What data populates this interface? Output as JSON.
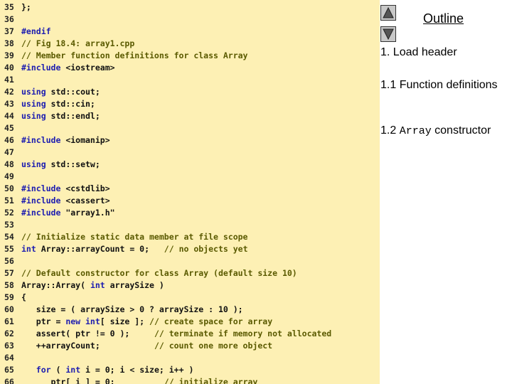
{
  "code": [
    {
      "n": "35",
      "parts": [
        {
          "t": "plain",
          "s": "};"
        }
      ]
    },
    {
      "n": "36",
      "parts": []
    },
    {
      "n": "37",
      "parts": [
        {
          "t": "pre",
          "s": "#endif"
        }
      ]
    },
    {
      "n": "38",
      "parts": [
        {
          "t": "comment",
          "s": "// Fig 18.4: array1.cpp"
        }
      ]
    },
    {
      "n": "39",
      "parts": [
        {
          "t": "comment",
          "s": "// Member function definitions for class Array"
        }
      ]
    },
    {
      "n": "40",
      "parts": [
        {
          "t": "pre",
          "s": "#include "
        },
        {
          "t": "plain",
          "s": "<iostream>"
        }
      ]
    },
    {
      "n": "41",
      "parts": []
    },
    {
      "n": "42",
      "parts": [
        {
          "t": "kw",
          "s": "using "
        },
        {
          "t": "plain",
          "s": "std::cout;"
        }
      ]
    },
    {
      "n": "43",
      "parts": [
        {
          "t": "kw",
          "s": "using "
        },
        {
          "t": "plain",
          "s": "std::cin;"
        }
      ]
    },
    {
      "n": "44",
      "parts": [
        {
          "t": "kw",
          "s": "using "
        },
        {
          "t": "plain",
          "s": "std::endl;"
        }
      ]
    },
    {
      "n": "45",
      "parts": []
    },
    {
      "n": "46",
      "parts": [
        {
          "t": "pre",
          "s": "#include "
        },
        {
          "t": "plain",
          "s": "<iomanip>"
        }
      ]
    },
    {
      "n": "47",
      "parts": []
    },
    {
      "n": "48",
      "parts": [
        {
          "t": "kw",
          "s": "using "
        },
        {
          "t": "plain",
          "s": "std::setw;"
        }
      ]
    },
    {
      "n": "49",
      "parts": []
    },
    {
      "n": "50",
      "parts": [
        {
          "t": "pre",
          "s": "#include "
        },
        {
          "t": "plain",
          "s": "<cstdlib>"
        }
      ]
    },
    {
      "n": "51",
      "parts": [
        {
          "t": "pre",
          "s": "#include "
        },
        {
          "t": "plain",
          "s": "<cassert>"
        }
      ]
    },
    {
      "n": "52",
      "parts": [
        {
          "t": "pre",
          "s": "#include "
        },
        {
          "t": "plain",
          "s": "\"array1.h\""
        }
      ]
    },
    {
      "n": "53",
      "parts": []
    },
    {
      "n": "54",
      "parts": [
        {
          "t": "comment",
          "s": "// Initialize static data member at file scope"
        }
      ]
    },
    {
      "n": "55",
      "parts": [
        {
          "t": "kw",
          "s": "int "
        },
        {
          "t": "plain",
          "s": "Array::arrayCount = 0;   "
        },
        {
          "t": "comment",
          "s": "// no objects yet"
        }
      ]
    },
    {
      "n": "56",
      "parts": []
    },
    {
      "n": "57",
      "parts": [
        {
          "t": "comment",
          "s": "// Default constructor for class Array (default size 10)"
        }
      ]
    },
    {
      "n": "58",
      "parts": [
        {
          "t": "plain",
          "s": "Array::Array( "
        },
        {
          "t": "kw",
          "s": "int "
        },
        {
          "t": "plain",
          "s": "arraySize )"
        }
      ]
    },
    {
      "n": "59",
      "parts": [
        {
          "t": "plain",
          "s": "{"
        }
      ]
    },
    {
      "n": "60",
      "parts": [
        {
          "t": "plain",
          "s": "   size = ( arraySize > 0 ? arraySize : 10 );"
        }
      ]
    },
    {
      "n": "61",
      "parts": [
        {
          "t": "plain",
          "s": "   ptr = "
        },
        {
          "t": "kw",
          "s": "new int"
        },
        {
          "t": "plain",
          "s": "[ size ]; "
        },
        {
          "t": "comment",
          "s": "// create space for array"
        }
      ]
    },
    {
      "n": "62",
      "parts": [
        {
          "t": "plain",
          "s": "   assert( ptr != 0 );     "
        },
        {
          "t": "comment",
          "s": "// terminate if memory not allocated"
        }
      ]
    },
    {
      "n": "63",
      "parts": [
        {
          "t": "plain",
          "s": "   ++arrayCount;           "
        },
        {
          "t": "comment",
          "s": "// count one more object"
        }
      ]
    },
    {
      "n": "64",
      "parts": []
    },
    {
      "n": "65",
      "parts": [
        {
          "t": "plain",
          "s": "   "
        },
        {
          "t": "kw",
          "s": "for "
        },
        {
          "t": "plain",
          "s": "( "
        },
        {
          "t": "kw",
          "s": "int "
        },
        {
          "t": "plain",
          "s": "i = 0; i < size; i++ )"
        }
      ]
    },
    {
      "n": "66",
      "parts": [
        {
          "t": "plain",
          "s": "      ptr[ i ] = 0;          "
        },
        {
          "t": "comment",
          "s": "// initialize array"
        }
      ]
    }
  ],
  "outline": {
    "title": "Outline",
    "items": [
      {
        "text": "1. Load header"
      },
      {
        "text": "1.1 Function definitions"
      },
      {
        "pre": "1.2 ",
        "mono": "Array",
        "post": " constructor"
      }
    ]
  },
  "nav": {
    "up_icon": "triangle-up-icon",
    "down_icon": "triangle-down-icon"
  },
  "colors": {
    "code_bg": "#fdf0b4",
    "comment": "#5a5a00",
    "keyword": "#1c1cb0",
    "button": "#c8c8c8"
  }
}
